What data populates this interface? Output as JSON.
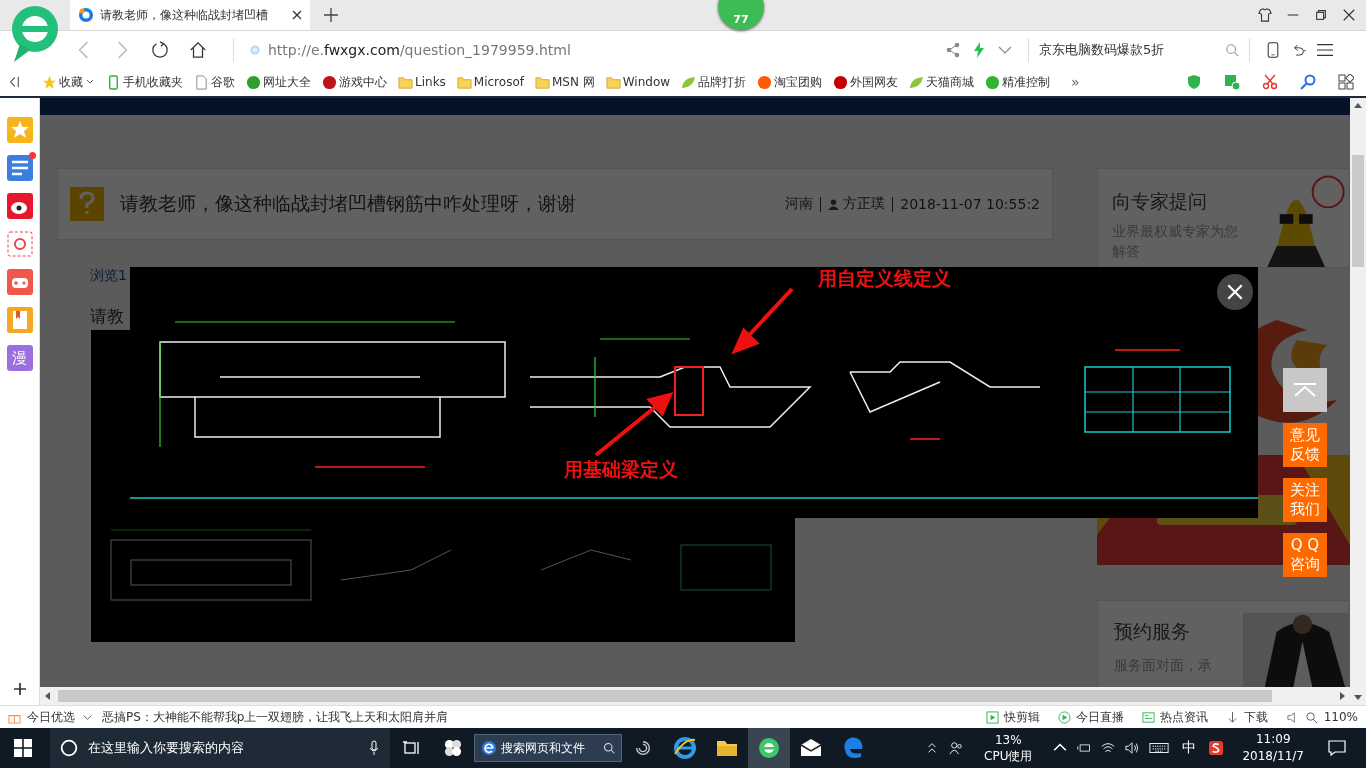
{
  "browser": {
    "badge": "77",
    "tabs": [
      {
        "title": "请教老师，像这种临战封堵凹槽",
        "selected": true
      }
    ],
    "address": {
      "url_scheme": "http://e.",
      "url_host": "fwxgx.com",
      "url_path": "/question_1979959.html",
      "search": "京东电脑数码爆款5折"
    },
    "bookmarks": [
      {
        "kind": "favorite",
        "label": "收藏"
      },
      {
        "kind": "phone",
        "label": "手机收藏夹"
      },
      {
        "kind": "page",
        "label": "谷歌"
      },
      {
        "kind": "site",
        "label": "网址大全",
        "color": "#2e9e2e"
      },
      {
        "kind": "site",
        "label": "游戏中心",
        "color": "#c0141c"
      },
      {
        "kind": "folder",
        "label": "Links"
      },
      {
        "kind": "folder",
        "label": "Microsof"
      },
      {
        "kind": "folder",
        "label": "MSN 网"
      },
      {
        "kind": "folder",
        "label": "Window"
      },
      {
        "kind": "leaf",
        "label": "品牌打折"
      },
      {
        "kind": "site",
        "label": "淘宝团购",
        "color": "#ff5a00"
      },
      {
        "kind": "site",
        "label": "外国网友",
        "color": "#c40000"
      },
      {
        "kind": "leaf",
        "label": "天猫商城"
      },
      {
        "kind": "site",
        "label": "精准控制",
        "color": "#2fb52f"
      }
    ],
    "bookmarks_more": "»"
  },
  "sidebar": [
    {
      "kind": "star",
      "dot": false
    },
    {
      "kind": "feed",
      "dot": true
    },
    {
      "kind": "weibo",
      "dot": false
    },
    {
      "kind": "mail",
      "dot": false
    },
    {
      "kind": "game",
      "dot": false
    },
    {
      "kind": "book",
      "dot": false
    },
    {
      "kind": "text",
      "label": "漫",
      "dot": false
    }
  ],
  "page": {
    "question": {
      "title": "请教老师，像这种临战封堵凹槽钢筋中咋处理呀，谢谢",
      "region": "河南",
      "author": "方正璞",
      "time": "2018-11-07 10:55:2"
    },
    "views": "浏览1",
    "body_start": "请教",
    "expert": {
      "title": "向专家提问",
      "subtitle": "业界最权威专家为您解答"
    },
    "service": {
      "title": "预约服务",
      "subtitle": "服务面对面，承"
    }
  },
  "lightbox": {
    "annotations": [
      {
        "text": "用自定义线定义"
      },
      {
        "text": "用基础梁定义"
      }
    ]
  },
  "float_buttons": [
    {
      "kind": "top"
    },
    {
      "kind": "text",
      "label": "意见反馈"
    },
    {
      "kind": "text",
      "label": "关注我们"
    },
    {
      "kind": "text",
      "label": "Q Q咨询"
    }
  ],
  "status_bar": {
    "today": "今日优选",
    "headline": "恶搞PS：大神能不能帮我p上一双翅膀，让我飞上天和太阳肩并肩",
    "items": [
      {
        "kind": "clip",
        "label": "快剪辑"
      },
      {
        "kind": "live",
        "label": "今日直播"
      },
      {
        "kind": "news",
        "label": "热点资讯"
      },
      {
        "kind": "download",
        "label": "下载"
      }
    ],
    "zoom": "110%"
  },
  "taskbar": {
    "search": "在这里输入你要搜索的内容",
    "web_search": "搜索网页和文件",
    "apps": [
      {
        "kind": "ie",
        "selected": false
      },
      {
        "kind": "folder",
        "selected": false
      },
      {
        "kind": "browser",
        "selected": true
      },
      {
        "kind": "mail",
        "selected": false
      },
      {
        "kind": "edge",
        "selected": false
      }
    ],
    "cpu": "13%",
    "cpu_label": "CPU使用",
    "ime": "中",
    "time": "11:09",
    "date": "2018/11/7"
  }
}
